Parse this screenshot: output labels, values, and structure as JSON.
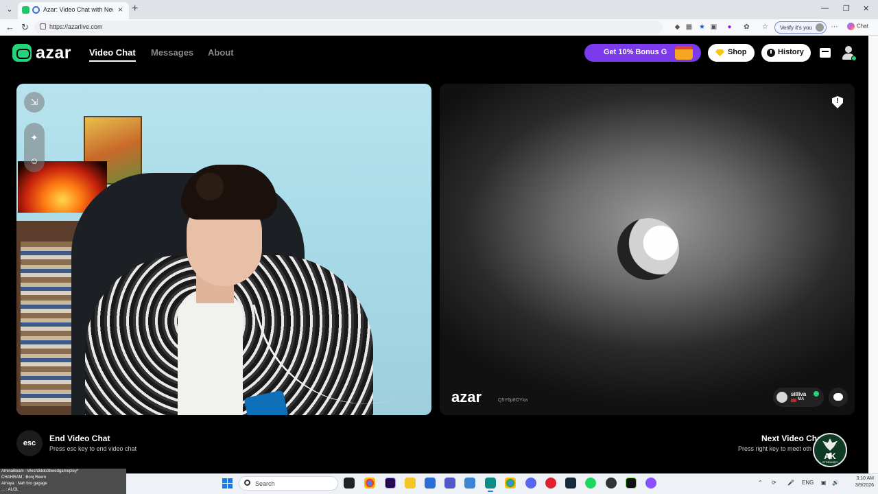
{
  "browser": {
    "tab_title": "Azar: Video Chat with New Pe",
    "url": "https://azarlive.com",
    "verify_label": "Verify it's you",
    "copilot_label": "Chat"
  },
  "app": {
    "logo_text": "azar",
    "nav": [
      {
        "label": "Video Chat",
        "active": true
      },
      {
        "label": "Messages",
        "active": false
      },
      {
        "label": "About",
        "active": false
      }
    ],
    "bonus_label": "Get 10% Bonus G",
    "shop_label": "Shop",
    "history_label": "History",
    "accent_color": "#24d47a",
    "bonus_color": "#7c3aed"
  },
  "remote": {
    "watermark": "azar",
    "watermark_id": "Q5Y6p8OYka",
    "username": "silliva",
    "country": "MA"
  },
  "controls": {
    "esc_key": "esc",
    "end_title": "End Video Chat",
    "end_sub": "Press esc key to end video chat",
    "next_title": "Next Video Chat",
    "next_sub": "Press right key to meet oth"
  },
  "badge": {
    "text": "AK",
    "sub": "STREAMER"
  },
  "overlay": {
    "lines": [
      "AminaBeam : Wesh3ddo3bwedgamepley*",
      "CHAHRAM   : Bonj Reem",
      "Amaya      : Nah bro gagage",
      "... : ALOL"
    ]
  },
  "taskbar": {
    "search_placeholder": "Search",
    "lang": "ENG",
    "time": "3:10 AM",
    "date": "3/9/2026"
  }
}
